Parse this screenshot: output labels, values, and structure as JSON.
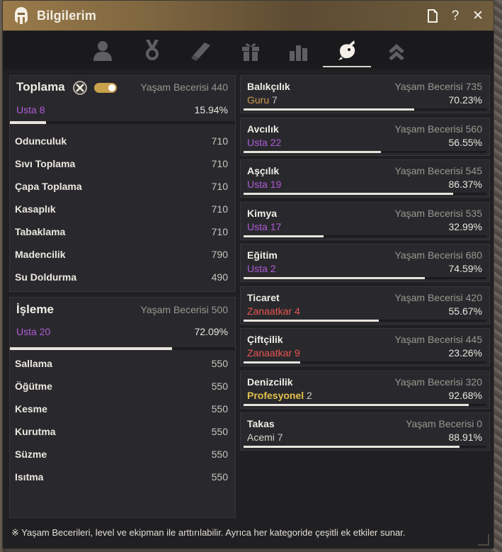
{
  "window": {
    "title": "Bilgilerim",
    "icons": {
      "logo": "helmet-icon",
      "doc": "document-icon",
      "help": "?",
      "close": "✕"
    }
  },
  "tabs": [
    {
      "icon": "profile-icon",
      "active": false
    },
    {
      "icon": "medal-icon",
      "active": false
    },
    {
      "icon": "scroll-icon",
      "active": false
    },
    {
      "icon": "gift-icon",
      "active": false
    },
    {
      "icon": "stats-icon",
      "active": false
    },
    {
      "icon": "life-skill-icon",
      "active": true
    },
    {
      "icon": "rank-icon",
      "active": false
    }
  ],
  "colors": {
    "usta": "#b15ad8",
    "guru": "#d39a4f",
    "zanaatkar": "#e8554f",
    "profesyonel": "#e4c04b",
    "acemi": "#d8d4cc"
  },
  "gathering": {
    "title": "Toplama",
    "life_label": "Yaşam Becerisi",
    "life_value": "440",
    "level_rank": "Usta",
    "level_num": "8",
    "percent": "15.94%",
    "progress": 0.1594,
    "toggle_on": true,
    "items": [
      {
        "name": "Odunculuk",
        "value": "710"
      },
      {
        "name": "Sıvı Toplama",
        "value": "710"
      },
      {
        "name": "Çapa Toplama",
        "value": "710"
      },
      {
        "name": "Kasaplık",
        "value": "710"
      },
      {
        "name": "Tabaklama",
        "value": "710"
      },
      {
        "name": "Madencilik",
        "value": "790"
      },
      {
        "name": "Su Doldurma",
        "value": "490"
      }
    ]
  },
  "processing": {
    "title": "İşleme",
    "life_label": "Yaşam Becerisi",
    "life_value": "500",
    "level_rank": "Usta",
    "level_num": "20",
    "percent": "72.09%",
    "progress": 0.7209,
    "items": [
      {
        "name": "Sallama",
        "value": "550"
      },
      {
        "name": "Öğütme",
        "value": "550"
      },
      {
        "name": "Kesme",
        "value": "550"
      },
      {
        "name": "Kurutma",
        "value": "550"
      },
      {
        "name": "Süzme",
        "value": "550"
      },
      {
        "name": "Isıtma",
        "value": "550"
      }
    ]
  },
  "skills": [
    {
      "name": "Balıkçılık",
      "life_label": "Yaşam Becerisi",
      "life_value": "735",
      "rank": "Guru",
      "rank_color": "guru",
      "level": "7",
      "percent": "70.23%",
      "progress": 0.7023
    },
    {
      "name": "Avcılık",
      "life_label": "Yaşam Becerisi",
      "life_value": "560",
      "rank": "Usta",
      "rank_color": "usta",
      "level": "22",
      "percent": "56.55%",
      "progress": 0.5655
    },
    {
      "name": "Aşçılık",
      "life_label": "Yaşam Becerisi",
      "life_value": "545",
      "rank": "Usta",
      "rank_color": "usta",
      "level": "19",
      "percent": "86.37%",
      "progress": 0.8637
    },
    {
      "name": "Kimya",
      "life_label": "Yaşam Becerisi",
      "life_value": "535",
      "rank": "Usta",
      "rank_color": "usta",
      "level": "17",
      "percent": "32.99%",
      "progress": 0.3299
    },
    {
      "name": "Eğitim",
      "life_label": "Yaşam Becerisi",
      "life_value": "680",
      "rank": "Usta",
      "rank_color": "usta",
      "level": "2",
      "percent": "74.59%",
      "progress": 0.7459
    },
    {
      "name": "Ticaret",
      "life_label": "Yaşam Becerisi",
      "life_value": "420",
      "rank": "Zanaatkar",
      "rank_color": "zanaatkar",
      "level": "4",
      "percent": "55.67%",
      "progress": 0.5567
    },
    {
      "name": "Çiftçilik",
      "life_label": "Yaşam Becerisi",
      "life_value": "445",
      "rank": "Zanaatkar",
      "rank_color": "zanaatkar",
      "level": "9",
      "percent": "23.26%",
      "progress": 0.2326
    },
    {
      "name": "Denizcilik",
      "life_label": "Yaşam Becerisi",
      "life_value": "320",
      "rank": "Profesyonel",
      "rank_color": "profesyonel",
      "level": "2",
      "percent": "92.68%",
      "progress": 0.9268
    },
    {
      "name": "Takas",
      "life_label": "Yaşam Becerisi",
      "life_value": "0",
      "rank": "Acemi",
      "rank_color": "acemi",
      "level": "7",
      "percent": "88.91%",
      "progress": 0.8891
    }
  ],
  "footer": {
    "note": "※ Yaşam Becerileri, level ve ekipman ile arttırılabilir. Ayrıca her kategoride çeşitli ek etkiler sunar."
  }
}
